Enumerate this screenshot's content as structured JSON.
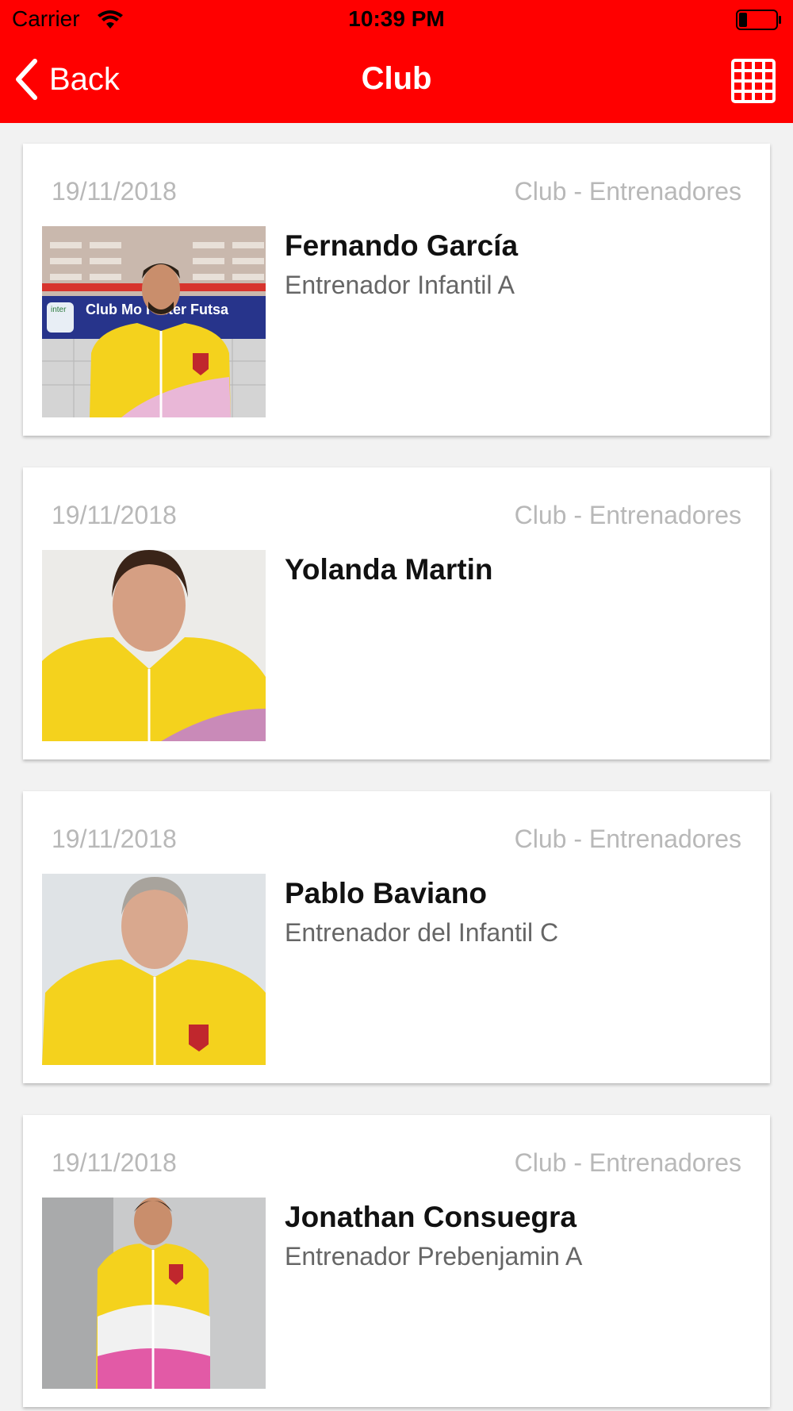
{
  "status_bar": {
    "carrier": "Carrier",
    "time": "10:39 PM",
    "wifi_icon": "wifi-icon",
    "battery_icon": "battery-icon"
  },
  "nav": {
    "back_label": "Back",
    "title": "Club",
    "grid_icon": "grid-icon",
    "background_color": "#ff0000"
  },
  "cards": [
    {
      "date": "19/11/2018",
      "category": "Club - Entrenadores",
      "name": "Fernando García",
      "role": "Entrenador Infantil A",
      "photo_banner": "Club Mo    r Inter Futsa",
      "photo_logo": "inter"
    },
    {
      "date": "19/11/2018",
      "category": "Club - Entrenadores",
      "name": "Yolanda Martin",
      "role": ""
    },
    {
      "date": "19/11/2018",
      "category": "Club - Entrenadores",
      "name": "Pablo Baviano",
      "role": "Entrenador del Infantil C"
    },
    {
      "date": "19/11/2018",
      "category": "Club - Entrenadores",
      "name": "Jonathan Consuegra",
      "role": "Entrenador Prebenjamin A"
    }
  ]
}
